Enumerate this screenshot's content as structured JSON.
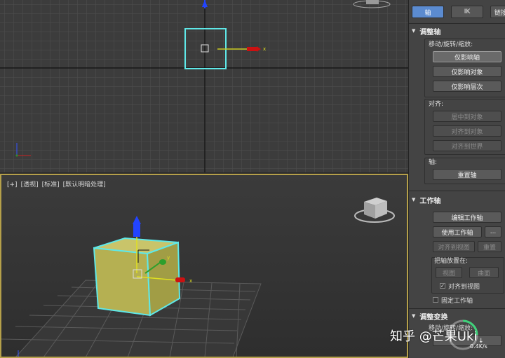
{
  "top_viewport": {
    "axis_x_label": "x"
  },
  "persp_viewport": {
    "label_plus": "[+]",
    "label_view": "[透视]",
    "label_shading": "[标准]",
    "label_lighting": "[默认明暗处理]",
    "axis_x_label": "x",
    "axis_y_label": "y"
  },
  "panel": {
    "tabs": [
      {
        "label": "轴",
        "active": true
      },
      {
        "label": "IK",
        "active": false
      },
      {
        "label": "链接",
        "active": false
      }
    ],
    "adjust_pivot": {
      "title": "调整轴",
      "move_rotate_scale": "移动/旋转/缩放:",
      "affect_pivot_only": "仅影响轴",
      "affect_object_only": "仅影响对象",
      "affect_hierarchy_only": "仅影响层次",
      "alignment": "对齐:",
      "center_to_object": "居中到对象",
      "align_to_object": "对齐到对象",
      "align_to_world": "对齐到世界",
      "pivot": "轴:",
      "reset_pivot": "重置轴"
    },
    "working_pivot": {
      "title": "工作轴",
      "edit_working_pivot": "编辑工作轴",
      "use_working_pivot": "使用工作轴",
      "more": "...",
      "align_to_view": "对齐到视图",
      "reset": "重置",
      "place_pivot_to": "把轴放置在:",
      "view": "视图",
      "surface": "曲面",
      "align_to_view_chk": "对齐到视图",
      "lock_working_pivot": "固定工作轴"
    },
    "adjust_transform": {
      "title": "调整变换",
      "move_rotate_scale": "移动/旋转/缩放:"
    }
  },
  "watermark": {
    "text": "知乎 @芒果Uki",
    "speed": "0.4K/s"
  },
  "colors": {
    "selection_cyan": "#5fe8e8",
    "cube_face": "#b5b052",
    "active_tab": "#5b8bd0",
    "viewport_border": "#b5a04a"
  }
}
